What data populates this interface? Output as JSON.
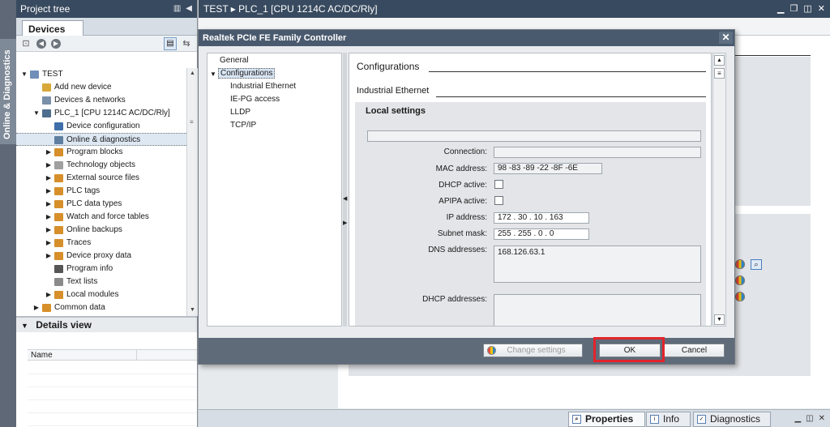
{
  "side_strip": {
    "label": "Online & Diagnostics"
  },
  "project_tree": {
    "title": "Project tree",
    "tab": "Devices",
    "items": [
      {
        "label": "TEST",
        "icon": "project-icon",
        "color": "#6f8fb8"
      },
      {
        "label": "Add new device",
        "icon": "add-device-icon",
        "color": "#d8a838"
      },
      {
        "label": "Devices & networks",
        "icon": "network-icon",
        "color": "#7a8fa8"
      },
      {
        "label": "PLC_1 [CPU 1214C AC/DC/Rly]",
        "icon": "plc-icon",
        "color": "#4e6e8e"
      },
      {
        "label": "Device configuration",
        "icon": "device-config-icon",
        "color": "#3f6fa8"
      },
      {
        "label": "Online & diagnostics",
        "icon": "online-diag-icon",
        "color": "#5f7fa0"
      },
      {
        "label": "Program blocks",
        "icon": "program-blocks-icon",
        "color": "#d68f2a"
      },
      {
        "label": "Technology objects",
        "icon": "technology-icon",
        "color": "#a0a0a0"
      },
      {
        "label": "External source files",
        "icon": "source-files-icon",
        "color": "#d68f2a"
      },
      {
        "label": "PLC tags",
        "icon": "plc-tags-icon",
        "color": "#d68f2a"
      },
      {
        "label": "PLC data types",
        "icon": "data-types-icon",
        "color": "#d68f2a"
      },
      {
        "label": "Watch and force tables",
        "icon": "watch-tables-icon",
        "color": "#d68f2a"
      },
      {
        "label": "Online backups",
        "icon": "backups-icon",
        "color": "#d68f2a"
      },
      {
        "label": "Traces",
        "icon": "traces-icon",
        "color": "#d68f2a"
      },
      {
        "label": "Device proxy data",
        "icon": "proxy-icon",
        "color": "#d68f2a"
      },
      {
        "label": "Program info",
        "icon": "program-info-icon",
        "color": "#555555"
      },
      {
        "label": "Text lists",
        "icon": "text-lists-icon",
        "color": "#8a8a8a"
      },
      {
        "label": "Local modules",
        "icon": "modules-icon",
        "color": "#d68f2a"
      },
      {
        "label": "Common data",
        "icon": "common-data-icon",
        "color": "#d68f2a"
      }
    ],
    "details_view": {
      "title": "Details view",
      "column": "Name"
    }
  },
  "main": {
    "title": "TEST ▸ PLC_1 [CPU 1214C AC/DC/Rly]",
    "bottom_tabs": [
      {
        "label": "Properties",
        "icon": "properties-icon"
      },
      {
        "label": "Info",
        "icon": "info-icon"
      },
      {
        "label": "Diagnostics",
        "icon": "diagnostics-icon"
      }
    ]
  },
  "dialog": {
    "title": "Realtek PCIe FE Family Controller",
    "nav": [
      "General",
      "Configurations",
      "Industrial Ethernet",
      "IE-PG access",
      "LLDP",
      "TCP/IP"
    ],
    "section_title": "Configurations",
    "subsection_title": "Industrial Ethernet",
    "local_settings": "Local settings",
    "fields": {
      "connection_label": "Connection:",
      "connection_value": "",
      "mac_label": "MAC address:",
      "mac_value": "98 -83 -89 -22 -8F -6E",
      "dhcp_label": "DHCP active:",
      "apipa_label": "APIPA active:",
      "ip_label": "IP address:",
      "ip_value": "172 . 30 . 10 . 163",
      "subnet_label": "Subnet mask:",
      "subnet_value": "255 . 255 . 0 . 0",
      "dns_label": "DNS addresses:",
      "dns_value": "168.126.63.1",
      "dhcp_addresses_label": "DHCP addresses:",
      "dhcp_addresses_value": ""
    },
    "buttons": {
      "change_settings": "Change settings",
      "ok": "OK",
      "cancel": "Cancel"
    }
  },
  "colors": {
    "title_bar": "#384a5f",
    "highlight": "#e3242b",
    "dialog_title": "#4a5a6e"
  }
}
